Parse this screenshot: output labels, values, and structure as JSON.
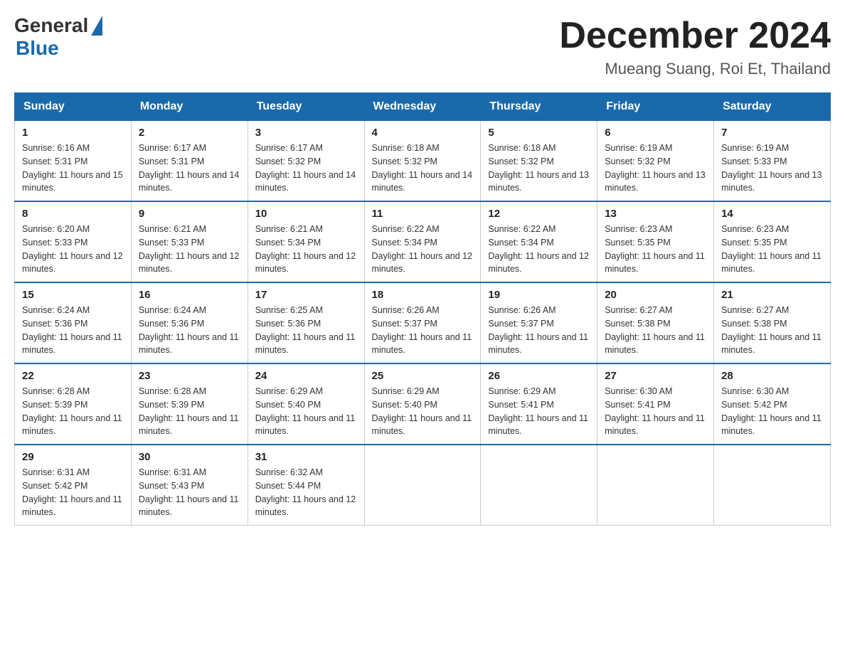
{
  "logo": {
    "general": "General",
    "blue": "Blue"
  },
  "title": "December 2024",
  "subtitle": "Mueang Suang, Roi Et, Thailand",
  "days_of_week": [
    "Sunday",
    "Monday",
    "Tuesday",
    "Wednesday",
    "Thursday",
    "Friday",
    "Saturday"
  ],
  "weeks": [
    [
      {
        "day": "1",
        "sunrise": "6:16 AM",
        "sunset": "5:31 PM",
        "daylight": "11 hours and 15 minutes."
      },
      {
        "day": "2",
        "sunrise": "6:17 AM",
        "sunset": "5:31 PM",
        "daylight": "11 hours and 14 minutes."
      },
      {
        "day": "3",
        "sunrise": "6:17 AM",
        "sunset": "5:32 PM",
        "daylight": "11 hours and 14 minutes."
      },
      {
        "day": "4",
        "sunrise": "6:18 AM",
        "sunset": "5:32 PM",
        "daylight": "11 hours and 14 minutes."
      },
      {
        "day": "5",
        "sunrise": "6:18 AM",
        "sunset": "5:32 PM",
        "daylight": "11 hours and 13 minutes."
      },
      {
        "day": "6",
        "sunrise": "6:19 AM",
        "sunset": "5:32 PM",
        "daylight": "11 hours and 13 minutes."
      },
      {
        "day": "7",
        "sunrise": "6:19 AM",
        "sunset": "5:33 PM",
        "daylight": "11 hours and 13 minutes."
      }
    ],
    [
      {
        "day": "8",
        "sunrise": "6:20 AM",
        "sunset": "5:33 PM",
        "daylight": "11 hours and 12 minutes."
      },
      {
        "day": "9",
        "sunrise": "6:21 AM",
        "sunset": "5:33 PM",
        "daylight": "11 hours and 12 minutes."
      },
      {
        "day": "10",
        "sunrise": "6:21 AM",
        "sunset": "5:34 PM",
        "daylight": "11 hours and 12 minutes."
      },
      {
        "day": "11",
        "sunrise": "6:22 AM",
        "sunset": "5:34 PM",
        "daylight": "11 hours and 12 minutes."
      },
      {
        "day": "12",
        "sunrise": "6:22 AM",
        "sunset": "5:34 PM",
        "daylight": "11 hours and 12 minutes."
      },
      {
        "day": "13",
        "sunrise": "6:23 AM",
        "sunset": "5:35 PM",
        "daylight": "11 hours and 11 minutes."
      },
      {
        "day": "14",
        "sunrise": "6:23 AM",
        "sunset": "5:35 PM",
        "daylight": "11 hours and 11 minutes."
      }
    ],
    [
      {
        "day": "15",
        "sunrise": "6:24 AM",
        "sunset": "5:36 PM",
        "daylight": "11 hours and 11 minutes."
      },
      {
        "day": "16",
        "sunrise": "6:24 AM",
        "sunset": "5:36 PM",
        "daylight": "11 hours and 11 minutes."
      },
      {
        "day": "17",
        "sunrise": "6:25 AM",
        "sunset": "5:36 PM",
        "daylight": "11 hours and 11 minutes."
      },
      {
        "day": "18",
        "sunrise": "6:26 AM",
        "sunset": "5:37 PM",
        "daylight": "11 hours and 11 minutes."
      },
      {
        "day": "19",
        "sunrise": "6:26 AM",
        "sunset": "5:37 PM",
        "daylight": "11 hours and 11 minutes."
      },
      {
        "day": "20",
        "sunrise": "6:27 AM",
        "sunset": "5:38 PM",
        "daylight": "11 hours and 11 minutes."
      },
      {
        "day": "21",
        "sunrise": "6:27 AM",
        "sunset": "5:38 PM",
        "daylight": "11 hours and 11 minutes."
      }
    ],
    [
      {
        "day": "22",
        "sunrise": "6:28 AM",
        "sunset": "5:39 PM",
        "daylight": "11 hours and 11 minutes."
      },
      {
        "day": "23",
        "sunrise": "6:28 AM",
        "sunset": "5:39 PM",
        "daylight": "11 hours and 11 minutes."
      },
      {
        "day": "24",
        "sunrise": "6:29 AM",
        "sunset": "5:40 PM",
        "daylight": "11 hours and 11 minutes."
      },
      {
        "day": "25",
        "sunrise": "6:29 AM",
        "sunset": "5:40 PM",
        "daylight": "11 hours and 11 minutes."
      },
      {
        "day": "26",
        "sunrise": "6:29 AM",
        "sunset": "5:41 PM",
        "daylight": "11 hours and 11 minutes."
      },
      {
        "day": "27",
        "sunrise": "6:30 AM",
        "sunset": "5:41 PM",
        "daylight": "11 hours and 11 minutes."
      },
      {
        "day": "28",
        "sunrise": "6:30 AM",
        "sunset": "5:42 PM",
        "daylight": "11 hours and 11 minutes."
      }
    ],
    [
      {
        "day": "29",
        "sunrise": "6:31 AM",
        "sunset": "5:42 PM",
        "daylight": "11 hours and 11 minutes."
      },
      {
        "day": "30",
        "sunrise": "6:31 AM",
        "sunset": "5:43 PM",
        "daylight": "11 hours and 11 minutes."
      },
      {
        "day": "31",
        "sunrise": "6:32 AM",
        "sunset": "5:44 PM",
        "daylight": "11 hours and 12 minutes."
      },
      null,
      null,
      null,
      null
    ]
  ]
}
